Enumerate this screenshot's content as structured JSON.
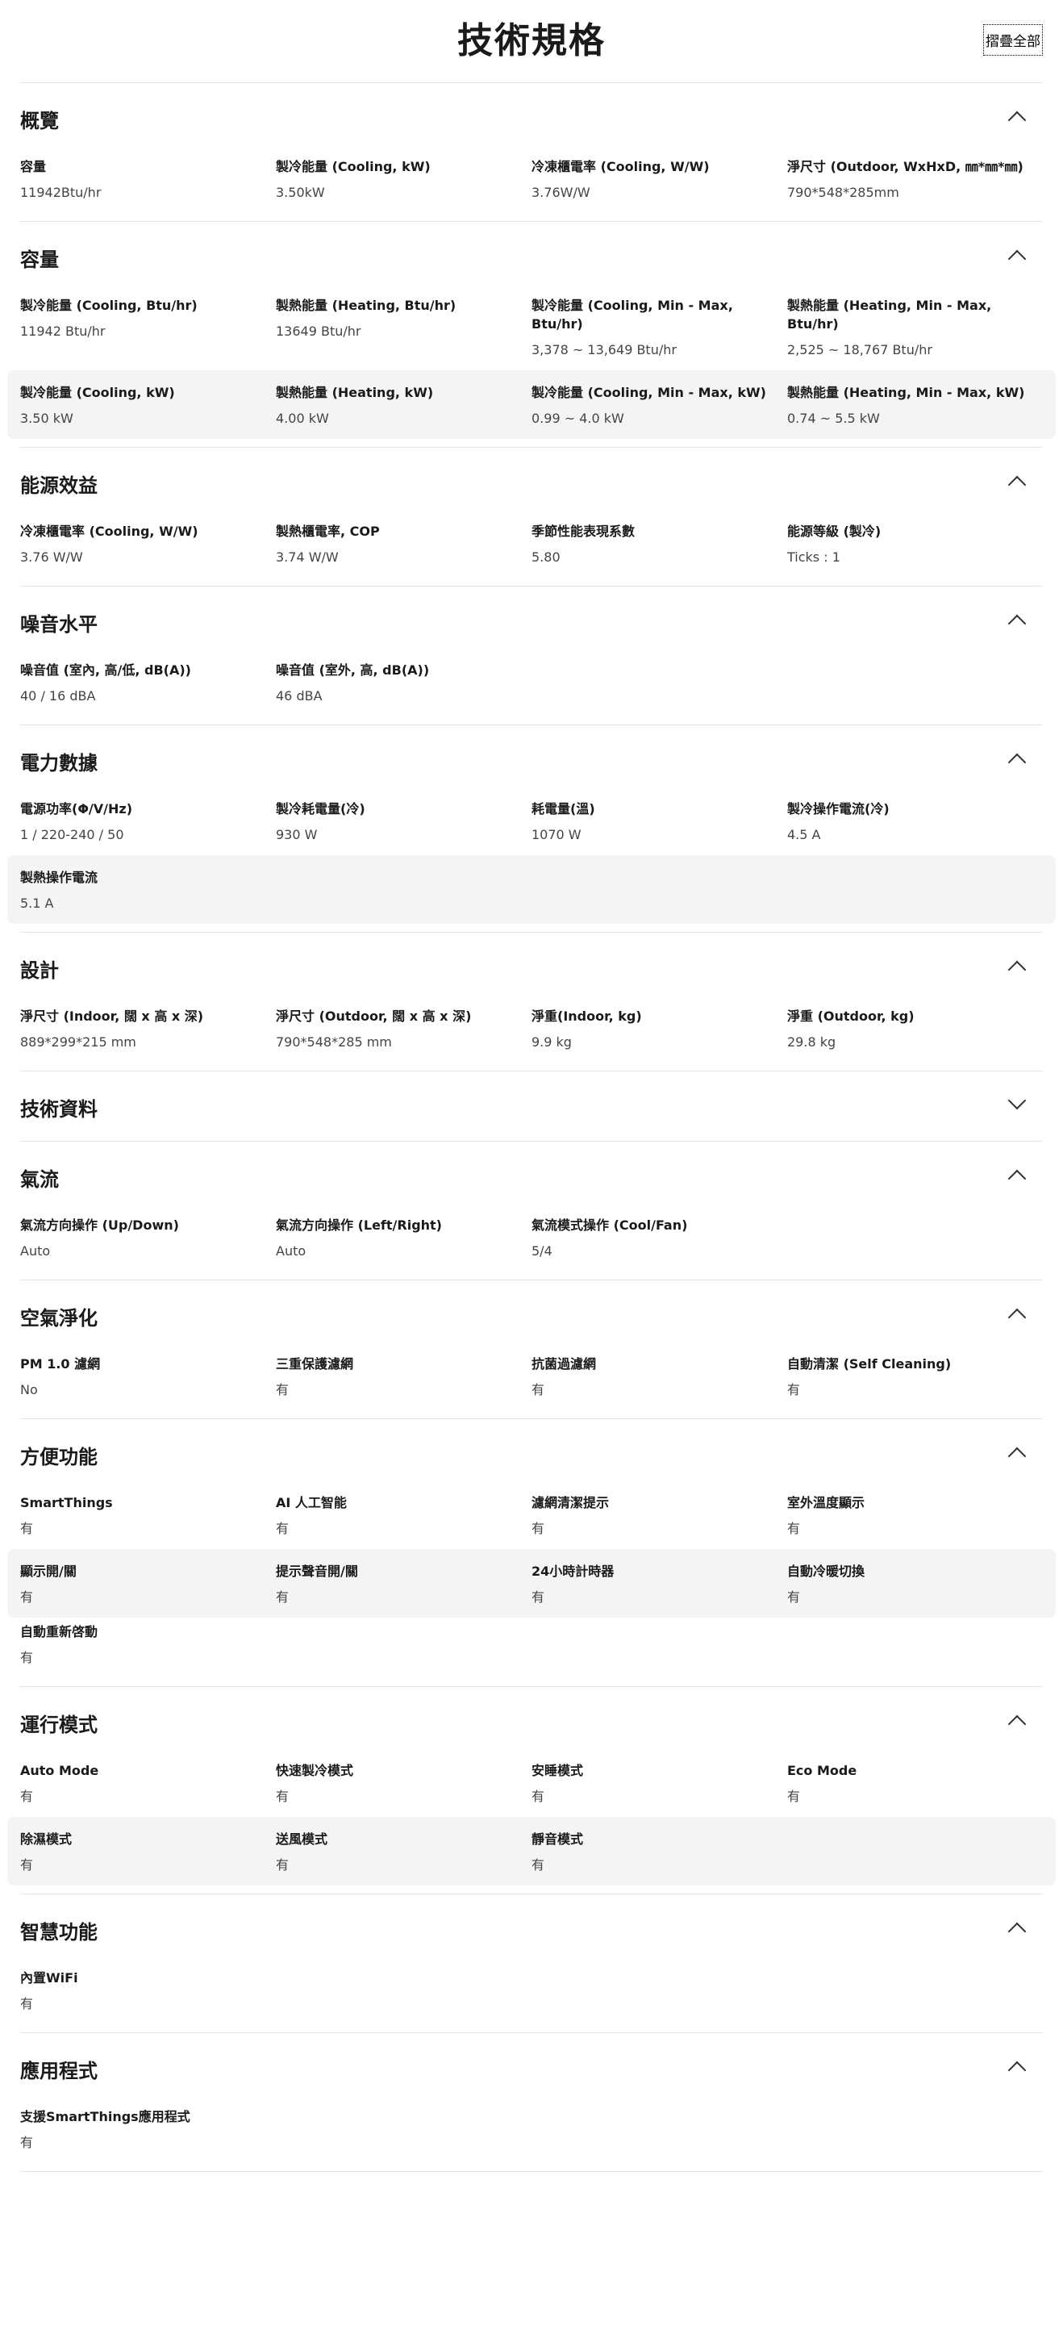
{
  "header": {
    "title": "技術規格",
    "collapse_all": "摺疊全部"
  },
  "sections": [
    {
      "title": "概覽",
      "rows": [
        [
          {
            "label": "容量",
            "value": "11942Btu/hr"
          },
          {
            "label": "製冷能量 (Cooling, kW)",
            "value": "3.50kW"
          },
          {
            "label": "冷凍櫃電率 (Cooling, W/W)",
            "value": "3.76W/W"
          },
          {
            "label": "淨尺寸 (Outdoor, WxHxD, ㎜*㎜*㎜)",
            "value": "790*548*285mm"
          }
        ]
      ]
    },
    {
      "title": "容量",
      "rows": [
        [
          {
            "label": "製冷能量 (Cooling, Btu/hr)",
            "value": "11942 Btu/hr"
          },
          {
            "label": "製熱能量 (Heating, Btu/hr)",
            "value": "13649 Btu/hr"
          },
          {
            "label": "製冷能量 (Cooling, Min - Max, Btu/hr)",
            "value": "3,378 ~ 13,649 Btu/hr"
          },
          {
            "label": "製熱能量 (Heating, Min - Max, Btu/hr)",
            "value": "2,525 ~ 18,767 Btu/hr"
          }
        ],
        [
          {
            "label": "製冷能量 (Cooling, kW)",
            "value": "3.50 kW"
          },
          {
            "label": "製熱能量 (Heating, kW)",
            "value": "4.00 kW"
          },
          {
            "label": "製冷能量 (Cooling, Min - Max, kW)",
            "value": "0.99 ~ 4.0 kW"
          },
          {
            "label": "製熱能量 (Heating, Min - Max, kW)",
            "value": "0.74 ~ 5.5 kW"
          }
        ]
      ]
    },
    {
      "title": "能源效益",
      "rows": [
        [
          {
            "label": "冷凍櫃電率 (Cooling, W/W)",
            "value": "3.76 W/W"
          },
          {
            "label": "製熱櫃電率, COP",
            "value": "3.74 W/W"
          },
          {
            "label": "季節性能表現系數",
            "value": "5.80"
          },
          {
            "label": "能源等級 (製冷)",
            "value": "Ticks : 1"
          }
        ]
      ]
    },
    {
      "title": "噪音水平",
      "rows": [
        [
          {
            "label": "噪音值 (室內, 高/低, dB(A))",
            "value": "40 / 16 dBA"
          },
          {
            "label": "噪音值 (室外, 高, dB(A))",
            "value": "46 dBA"
          }
        ]
      ]
    },
    {
      "title": "電力數據",
      "rows": [
        [
          {
            "label": "電源功率(Φ/V/Hz)",
            "value": "1 / 220-240 / 50"
          },
          {
            "label": "製冷耗電量(冷)",
            "value": "930 W"
          },
          {
            "label": "耗電量(溫)",
            "value": "1070 W"
          },
          {
            "label": "製冷操作電流(冷)",
            "value": "4.5 A"
          }
        ],
        [
          {
            "label": "製熱操作電流",
            "value": "5.1 A"
          }
        ]
      ]
    },
    {
      "title": "設計",
      "rows": [
        [
          {
            "label": "淨尺寸 (Indoor, 闊 x 高 x 深)",
            "value": "889*299*215 mm"
          },
          {
            "label": "淨尺寸 (Outdoor, 闊 x 高 x 深)",
            "value": "790*548*285 mm"
          },
          {
            "label": "淨重(Indoor, kg)",
            "value": "9.9 kg"
          },
          {
            "label": "淨重 (Outdoor, kg)",
            "value": "29.8 kg"
          }
        ]
      ]
    },
    {
      "title": "技術資料",
      "collapsed": true,
      "rows": []
    },
    {
      "title": "氣流",
      "rows": [
        [
          {
            "label": "氣流方向操作 (Up/Down)",
            "value": "Auto"
          },
          {
            "label": "氣流方向操作 (Left/Right)",
            "value": "Auto"
          },
          {
            "label": "氣流模式操作 (Cool/Fan)",
            "value": "5/4"
          }
        ]
      ]
    },
    {
      "title": "空氣淨化",
      "rows": [
        [
          {
            "label": "PM 1.0 濾網",
            "value": "No"
          },
          {
            "label": "三重保護濾網",
            "value": "有"
          },
          {
            "label": "抗菌過濾網",
            "value": "有"
          },
          {
            "label": "自動清潔 (Self Cleaning)",
            "value": "有"
          }
        ]
      ]
    },
    {
      "title": "方便功能",
      "rows": [
        [
          {
            "label": "SmartThings",
            "value": "有"
          },
          {
            "label": "AI 人工智能",
            "value": "有"
          },
          {
            "label": "濾網清潔提示",
            "value": "有"
          },
          {
            "label": "室外溫度顯示",
            "value": "有"
          }
        ],
        [
          {
            "label": "顯示開/關",
            "value": "有"
          },
          {
            "label": "提示聲音開/關",
            "value": "有"
          },
          {
            "label": "24小時計時器",
            "value": "有"
          },
          {
            "label": "自動冷暖切換",
            "value": "有"
          }
        ],
        [
          {
            "label": "自動重新啓動",
            "value": "有"
          }
        ]
      ]
    },
    {
      "title": "運行模式",
      "rows": [
        [
          {
            "label": "Auto Mode",
            "value": "有"
          },
          {
            "label": "快速製冷模式",
            "value": "有"
          },
          {
            "label": "安睡模式",
            "value": "有"
          },
          {
            "label": "Eco Mode",
            "value": "有"
          }
        ],
        [
          {
            "label": "除濕模式",
            "value": "有"
          },
          {
            "label": "送風模式",
            "value": "有"
          },
          {
            "label": "靜音模式",
            "value": "有"
          }
        ]
      ]
    },
    {
      "title": "智慧功能",
      "rows": [
        [
          {
            "label": "內置WiFi",
            "value": "有"
          }
        ]
      ]
    },
    {
      "title": "應用程式",
      "rows": [
        [
          {
            "label": "支援SmartThings應用程式",
            "value": "有"
          }
        ]
      ]
    }
  ]
}
